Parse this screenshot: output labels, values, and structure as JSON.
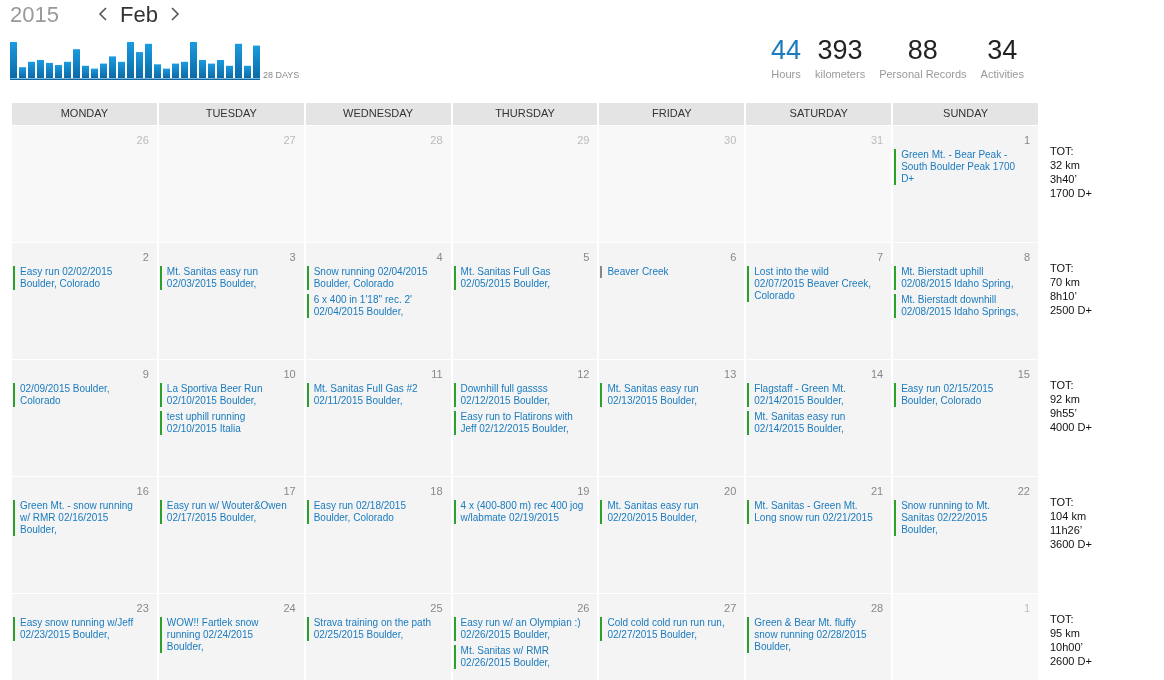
{
  "header": {
    "year": "2015",
    "month": "Feb",
    "chart_caption": "28 DAYS"
  },
  "stats": [
    {
      "value": "44",
      "label": "Hours",
      "selected": true
    },
    {
      "value": "393",
      "label": "kilometers",
      "selected": false
    },
    {
      "value": "88",
      "label": "Personal Records",
      "selected": false
    },
    {
      "value": "34",
      "label": "Activities",
      "selected": false
    }
  ],
  "weekdays": [
    "MONDAY",
    "TUESDAY",
    "WEDNESDAY",
    "THURSDAY",
    "FRIDAY",
    "SATURDAY",
    "SUNDAY"
  ],
  "weeks": [
    {
      "days": [
        {
          "number": "26",
          "in_month": false
        },
        {
          "number": "27",
          "in_month": false
        },
        {
          "number": "28",
          "in_month": false
        },
        {
          "number": "29",
          "in_month": false
        },
        {
          "number": "30",
          "in_month": false
        },
        {
          "number": "31",
          "in_month": false
        },
        {
          "number": "1",
          "in_month": true,
          "activities": [
            {
              "title": "Green Mt. - Bear Peak - South Boulder Peak 1700 D+",
              "color": "#2ca02c"
            }
          ]
        }
      ],
      "total": [
        "TOT:",
        "32 km",
        "3h40’",
        "1700 D+"
      ]
    },
    {
      "days": [
        {
          "number": "2",
          "in_month": true,
          "activities": [
            {
              "title": "Easy run 02/02/2015 Boulder, Colorado",
              "color": "#2ca02c"
            }
          ]
        },
        {
          "number": "3",
          "in_month": true,
          "activities": [
            {
              "title": "Mt. Sanitas easy run 02/03/2015 Boulder,",
              "color": "#2ca02c"
            }
          ]
        },
        {
          "number": "4",
          "in_month": true,
          "activities": [
            {
              "title": "Snow running 02/04/2015 Boulder, Colorado",
              "color": "#2ca02c"
            },
            {
              "title": "6 x 400 in 1'18'' rec. 2' 02/04/2015 Boulder,",
              "color": "#2ca02c"
            }
          ]
        },
        {
          "number": "5",
          "in_month": true,
          "activities": [
            {
              "title": "Mt. Sanitas Full Gas 02/05/2015 Boulder,",
              "color": "#2ca02c"
            }
          ]
        },
        {
          "number": "6",
          "in_month": true,
          "activities": [
            {
              "title": "Beaver Creek",
              "color": "#888888"
            }
          ]
        },
        {
          "number": "7",
          "in_month": true,
          "activities": [
            {
              "title": "Lost into the wild 02/07/2015 Beaver Creek, Colorado",
              "color": "#2ca02c"
            }
          ]
        },
        {
          "number": "8",
          "in_month": true,
          "activities": [
            {
              "title": "Mt. Bierstadt uphill 02/08/2015 Idaho Spring,",
              "color": "#2ca02c"
            },
            {
              "title": "Mt. Bierstadt downhill 02/08/2015 Idaho Springs,",
              "color": "#2ca02c"
            }
          ]
        }
      ],
      "total": [
        "TOT:",
        "70 km",
        "8h10’",
        "2500 D+"
      ]
    },
    {
      "days": [
        {
          "number": "9",
          "in_month": true,
          "activities": [
            {
              "title": "02/09/2015 Boulder, Colorado",
              "color": "#2ca02c"
            }
          ]
        },
        {
          "number": "10",
          "in_month": true,
          "activities": [
            {
              "title": "La Sportiva Beer Run 02/10/2015 Boulder,",
              "color": "#2ca02c"
            },
            {
              "title": "test uphill running 02/10/2015 Italia",
              "color": "#2ca02c"
            }
          ]
        },
        {
          "number": "11",
          "in_month": true,
          "activities": [
            {
              "title": "Mt. Sanitas Full Gas #2 02/11/2015 Boulder,",
              "color": "#2ca02c"
            }
          ]
        },
        {
          "number": "12",
          "in_month": true,
          "activities": [
            {
              "title": "Downhill full gassss 02/12/2015 Boulder,",
              "color": "#2ca02c"
            },
            {
              "title": "Easy run to Flatirons with Jeff 02/12/2015 Boulder,",
              "color": "#2ca02c"
            }
          ]
        },
        {
          "number": "13",
          "in_month": true,
          "activities": [
            {
              "title": "Mt. Sanitas easy run 02/13/2015 Boulder,",
              "color": "#2ca02c"
            }
          ]
        },
        {
          "number": "14",
          "in_month": true,
          "activities": [
            {
              "title": "Flagstaff - Green Mt. 02/14/2015 Boulder,",
              "color": "#2ca02c"
            },
            {
              "title": "Mt. Sanitas easy run 02/14/2015 Boulder,",
              "color": "#2ca02c"
            }
          ]
        },
        {
          "number": "15",
          "in_month": true,
          "activities": [
            {
              "title": "Easy run 02/15/2015 Boulder, Colorado",
              "color": "#2ca02c"
            }
          ]
        }
      ],
      "total": [
        "TOT:",
        "92 km",
        "9h55’",
        "4000 D+"
      ]
    },
    {
      "days": [
        {
          "number": "16",
          "in_month": true,
          "activities": [
            {
              "title": "Green Mt. - snow running w/ RMR 02/16/2015 Boulder,",
              "color": "#2ca02c"
            }
          ]
        },
        {
          "number": "17",
          "in_month": true,
          "activities": [
            {
              "title": "Easy run w/ Wouter&Owen 02/17/2015 Boulder,",
              "color": "#2ca02c"
            }
          ]
        },
        {
          "number": "18",
          "in_month": true,
          "activities": [
            {
              "title": "Easy run 02/18/2015 Boulder, Colorado",
              "color": "#2ca02c"
            }
          ]
        },
        {
          "number": "19",
          "in_month": true,
          "activities": [
            {
              "title": "4 x (400-800 m) rec 400 jog w/labmate 02/19/2015",
              "color": "#2ca02c"
            }
          ]
        },
        {
          "number": "20",
          "in_month": true,
          "activities": [
            {
              "title": "Mt. Sanitas easy run 02/20/2015 Boulder,",
              "color": "#2ca02c"
            }
          ]
        },
        {
          "number": "21",
          "in_month": true,
          "activities": [
            {
              "title": "Mt. Sanitas - Green Mt. Long snow run 02/21/2015",
              "color": "#2ca02c"
            }
          ]
        },
        {
          "number": "22",
          "in_month": true,
          "activities": [
            {
              "title": "Snow running to Mt. Sanitas 02/22/2015 Boulder,",
              "color": "#2ca02c"
            }
          ]
        }
      ],
      "total": [
        "TOT:",
        "104 km",
        "11h26’",
        "3600 D+"
      ]
    },
    {
      "days": [
        {
          "number": "23",
          "in_month": true,
          "activities": [
            {
              "title": "Easy snow running w/Jeff 02/23/2015 Boulder,",
              "color": "#2ca02c"
            }
          ]
        },
        {
          "number": "24",
          "in_month": true,
          "activities": [
            {
              "title": "WOW!! Fartlek snow running 02/24/2015 Boulder,",
              "color": "#2ca02c"
            }
          ]
        },
        {
          "number": "25",
          "in_month": true,
          "activities": [
            {
              "title": "Strava training on the path 02/25/2015 Boulder,",
              "color": "#2ca02c"
            }
          ]
        },
        {
          "number": "26",
          "in_month": true,
          "activities": [
            {
              "title": "Easy run w/ an Olympian :) 02/26/2015 Boulder,",
              "color": "#2ca02c"
            },
            {
              "title": "Mt. Sanitas w/ RMR 02/26/2015 Boulder,",
              "color": "#2ca02c"
            }
          ]
        },
        {
          "number": "27",
          "in_month": true,
          "activities": [
            {
              "title": "Cold cold cold run run run, 02/27/2015 Boulder,",
              "color": "#2ca02c"
            }
          ]
        },
        {
          "number": "28",
          "in_month": true,
          "activities": [
            {
              "title": "Green & Bear Mt. fluffy snow running 02/28/2015 Boulder,",
              "color": "#2ca02c"
            }
          ]
        },
        {
          "number": "1",
          "in_month": false
        }
      ],
      "total": [
        "TOT:",
        "95 km",
        "10h00’",
        "2600 D+"
      ]
    }
  ]
}
